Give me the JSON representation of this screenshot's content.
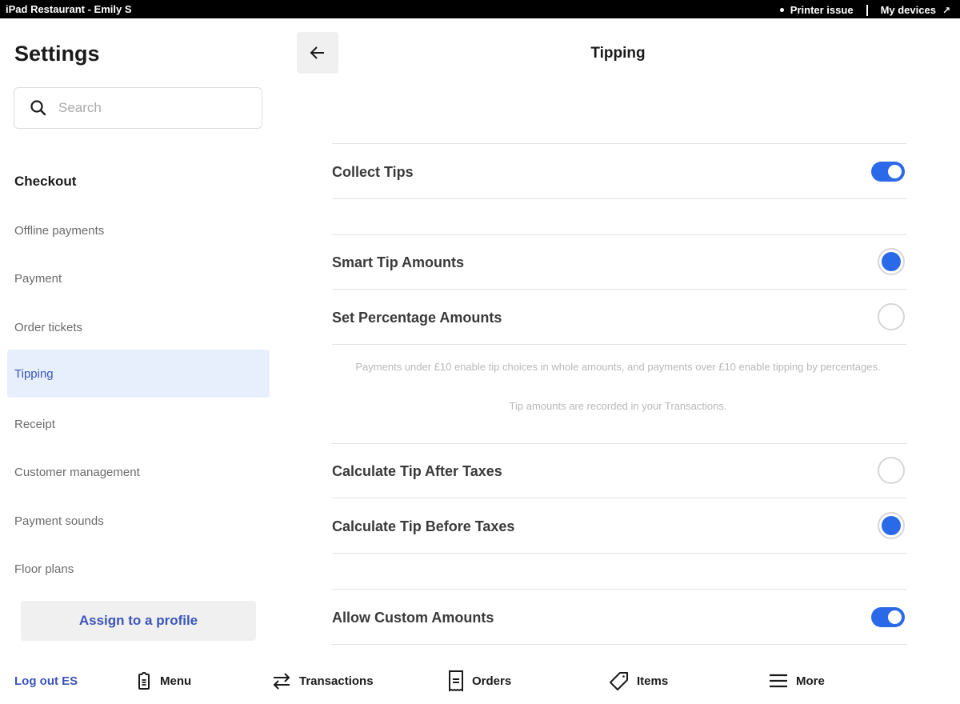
{
  "statusbar": {
    "title": "iPad Restaurant - Emily S",
    "printer_status": "Printer issue",
    "devices_link": "My devices",
    "devices_arrow": "↗"
  },
  "sidebar": {
    "title": "Settings",
    "search_placeholder": "Search",
    "section_title": "Checkout",
    "items": [
      {
        "label": "Offline payments",
        "active": false
      },
      {
        "label": "Payment",
        "active": false
      },
      {
        "label": "Order tickets",
        "active": false
      },
      {
        "label": "Tipping",
        "active": true
      },
      {
        "label": "Receipt",
        "active": false
      },
      {
        "label": "Customer management",
        "active": false
      },
      {
        "label": "Payment sounds",
        "active": false
      },
      {
        "label": "Floor plans",
        "active": false
      }
    ],
    "assign_button": "Assign to a profile"
  },
  "main": {
    "title": "Tipping",
    "collect_tips": {
      "label": "Collect Tips",
      "on": true
    },
    "tip_mode": {
      "options": [
        {
          "label": "Smart Tip Amounts",
          "selected": true
        },
        {
          "label": "Set Percentage Amounts",
          "selected": false
        }
      ]
    },
    "note_1": "Payments under £10 enable tip choices in whole amounts, and payments over £10 enable tipping by percentages.",
    "note_2": "Tip amounts are recorded in your Transactions.",
    "tax_mode": {
      "options": [
        {
          "label": "Calculate Tip After Taxes",
          "selected": false
        },
        {
          "label": "Calculate Tip Before Taxes",
          "selected": true
        }
      ]
    },
    "custom_amounts": {
      "label": "Allow Custom Amounts",
      "on": true
    }
  },
  "tabbar": {
    "logout": "Log out ES",
    "tabs": [
      {
        "label": "Menu",
        "icon": "menu-clipboard-icon"
      },
      {
        "label": "Transactions",
        "icon": "transactions-arrows-icon"
      },
      {
        "label": "Orders",
        "icon": "receipt-icon"
      },
      {
        "label": "Items",
        "icon": "tag-icon"
      },
      {
        "label": "More",
        "icon": "hamburger-icon"
      }
    ]
  },
  "colors": {
    "accent": "#2a6ae8",
    "link": "#3b55b8",
    "active_bg": "#e8effc"
  }
}
